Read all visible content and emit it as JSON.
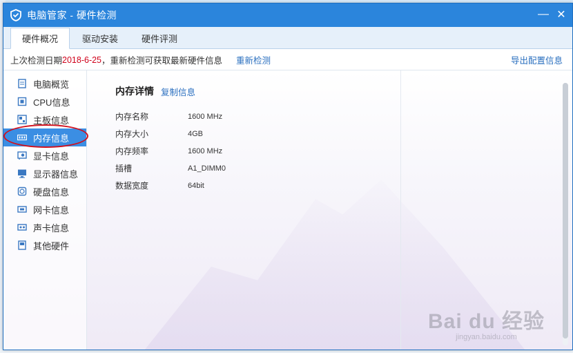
{
  "window": {
    "title": "电脑管家 - 硬件检测",
    "minimize_label": "—",
    "close_label": "✕"
  },
  "tabs": [
    {
      "label": "硬件概况",
      "active": true
    },
    {
      "label": "驱动安装",
      "active": false
    },
    {
      "label": "硬件评测",
      "active": false
    }
  ],
  "infobar": {
    "prefix": "上次检测日期 ",
    "date": "2018-6-25",
    "suffix": "，重新检测可获取最新硬件信息",
    "recheck_link": "重新检测",
    "export_link": "导出配置信息"
  },
  "sidebar": {
    "items": [
      {
        "label": "电脑概览",
        "icon": "overview-icon"
      },
      {
        "label": "CPU信息",
        "icon": "cpu-icon"
      },
      {
        "label": "主板信息",
        "icon": "motherboard-icon"
      },
      {
        "label": "内存信息",
        "icon": "memory-icon"
      },
      {
        "label": "显卡信息",
        "icon": "graphics-card-icon"
      },
      {
        "label": "显示器信息",
        "icon": "monitor-icon"
      },
      {
        "label": "硬盘信息",
        "icon": "harddisk-icon"
      },
      {
        "label": "网卡信息",
        "icon": "network-card-icon"
      },
      {
        "label": "声卡信息",
        "icon": "sound-card-icon"
      },
      {
        "label": "其他硬件",
        "icon": "other-hardware-icon"
      }
    ],
    "active_index": 3
  },
  "detail": {
    "heading": "内存详情",
    "copy_link": "复制信息",
    "rows": [
      {
        "key": "内存名称",
        "value": "1600 MHz"
      },
      {
        "key": "内存大小",
        "value": "4GB"
      },
      {
        "key": "内存频率",
        "value": "1600 MHz"
      },
      {
        "key": "插槽",
        "value": "A1_DIMM0"
      },
      {
        "key": "数据宽度",
        "value": "64bit"
      }
    ]
  },
  "watermark": {
    "line1": "Bai du 经验",
    "line2": "jingyan.baidu.com"
  },
  "colors": {
    "titlebar": "#2b85dc",
    "accent_link": "#2a6fbf",
    "date_red": "#d0021b",
    "active_item": "#3b8ee3",
    "annotation_ring": "#d0101d"
  }
}
